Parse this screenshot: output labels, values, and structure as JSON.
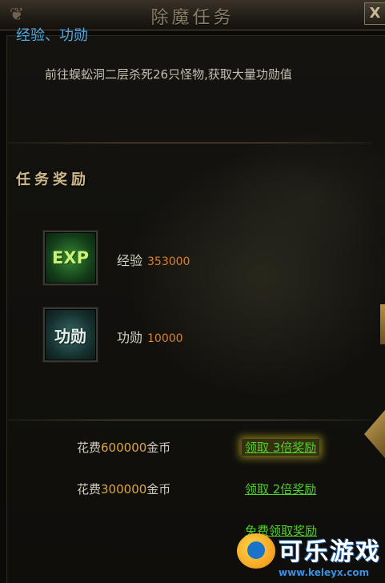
{
  "window": {
    "title": "除魔任务",
    "close_label": "X"
  },
  "quest": {
    "heading": "经验、功勋",
    "description": "前往蜈蚣洞二层杀死26只怪物,获取大量功勋值"
  },
  "rewards": {
    "title": "任务奖励",
    "items": [
      {
        "icon": "exp-icon",
        "icon_text": "EXP",
        "label": "经验",
        "value": "353000"
      },
      {
        "icon": "merit-icon",
        "icon_text": "功勋",
        "label": "功勋",
        "value": "10000"
      }
    ]
  },
  "claims": [
    {
      "cost_prefix": "花费",
      "cost_amount": "600000",
      "cost_suffix": "金币",
      "action": "领取 3倍奖励"
    },
    {
      "cost_prefix": "花费",
      "cost_amount": "300000",
      "cost_suffix": "金币",
      "action": "领取 2倍奖励"
    },
    {
      "action": "免费领取奖励"
    }
  ],
  "watermark": {
    "brand": "可乐游戏",
    "url": "www.keleyx.com"
  }
}
